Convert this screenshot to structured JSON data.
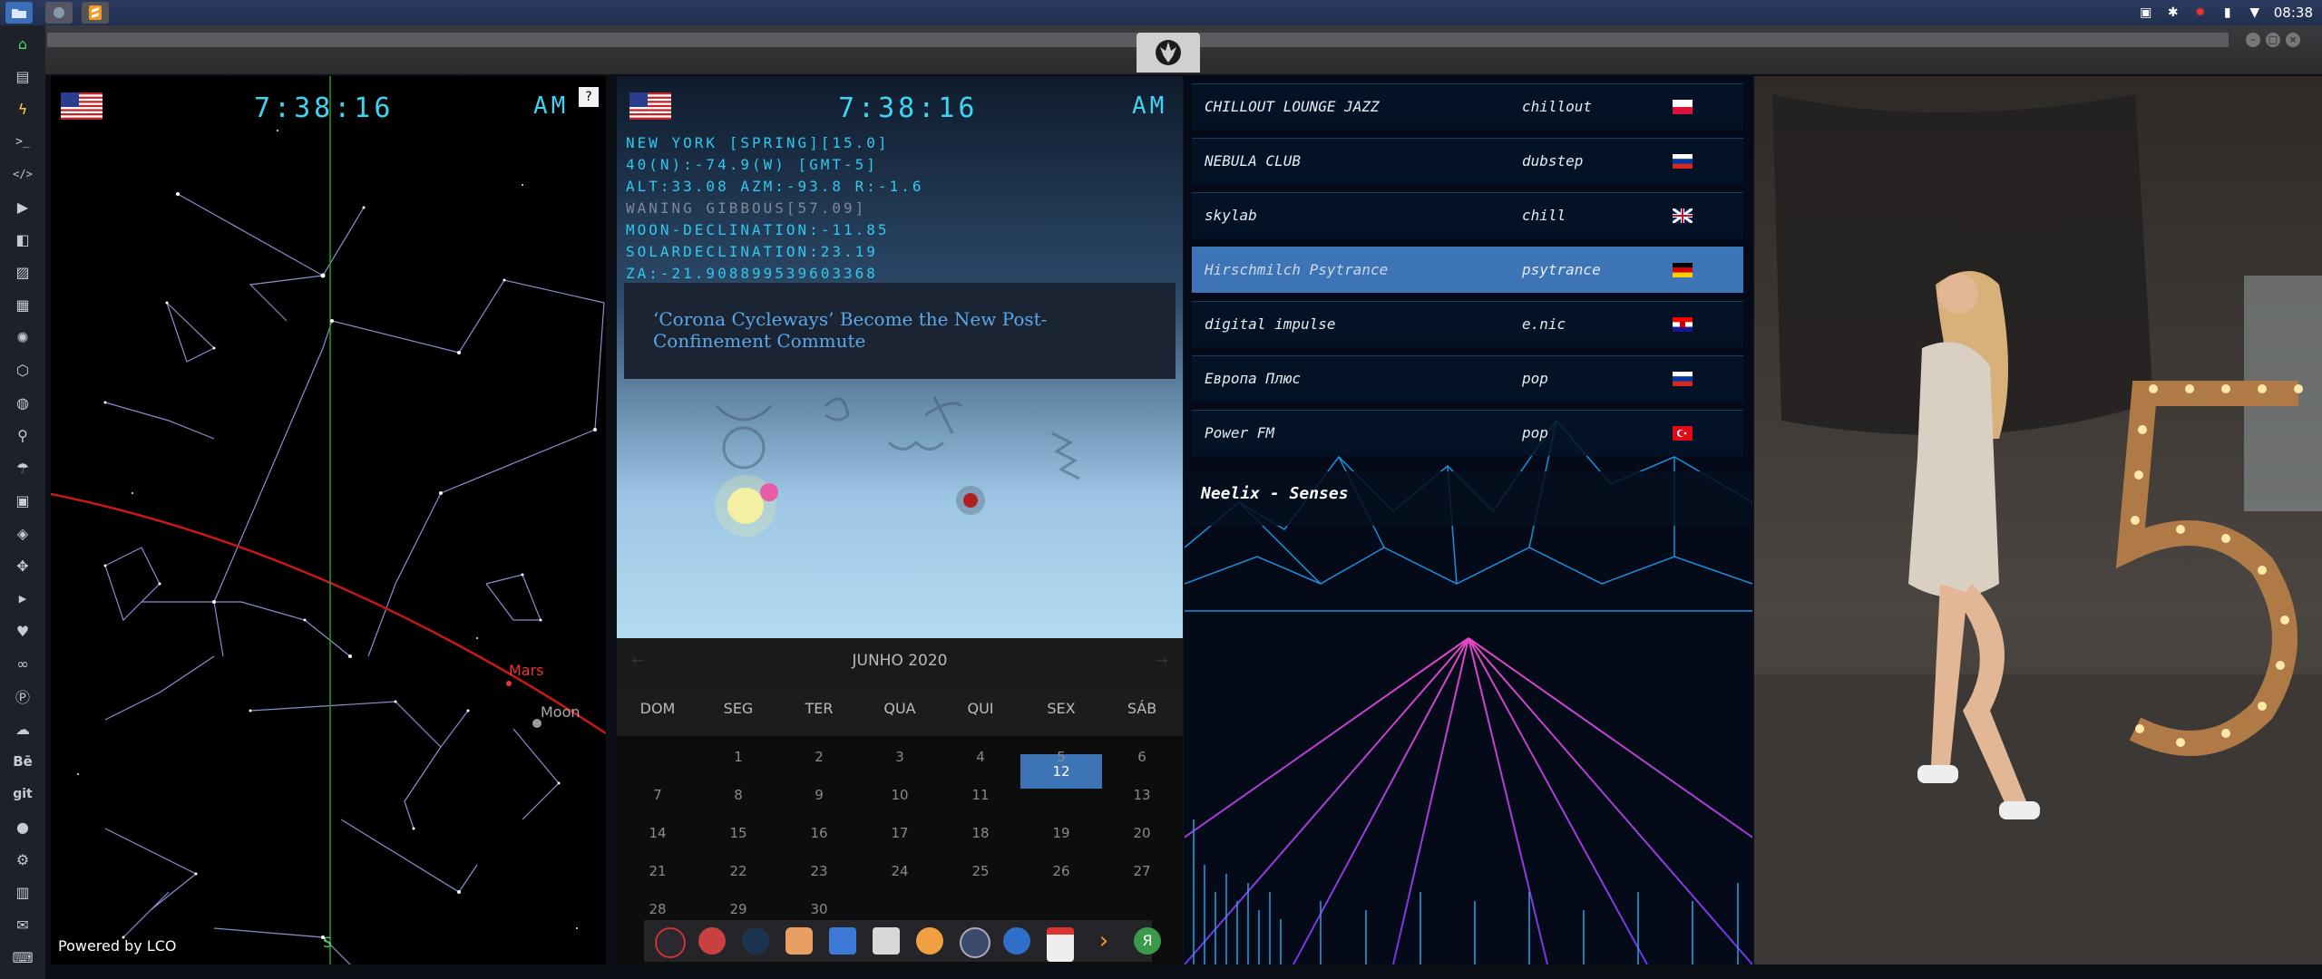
{
  "panel": {
    "time": "08:38"
  },
  "sky": {
    "clock": "7:38:16",
    "ampm": "AM",
    "help": "?",
    "mars_label": "Mars",
    "moon_label": "Moon",
    "south_label": "S",
    "powered_by": "Powered by LCO"
  },
  "astro": {
    "clock": "7:38:16",
    "ampm": "AM",
    "info": [
      "NEW YORK [SPRING][15.0]",
      "40(N):-74.9(W) [GMT-5]",
      "ALT:33.08 AZM:-93.8 R:-1.6",
      "WANING GIBBOUS[57.09]",
      "MOON-DECLINATION:-11.85",
      "SOLARDECLINATION:23.19",
      "ZA:-21.908899539603368"
    ],
    "news_headline": "‘Corona Cycleways’ Become the New Post-Confinement Commute",
    "calendar": {
      "month": "JUNHO 2020",
      "weekdays": [
        "DOM",
        "SEG",
        "TER",
        "QUA",
        "QUI",
        "SEX",
        "SÁB"
      ],
      "today": "12",
      "weeks": [
        [
          "",
          "1",
          "2",
          "3",
          "4",
          "5",
          "6"
        ],
        [
          "7",
          "8",
          "9",
          "10",
          "11",
          "12",
          "13"
        ],
        [
          "14",
          "15",
          "16",
          "17",
          "18",
          "19",
          "20"
        ],
        [
          "21",
          "22",
          "23",
          "24",
          "25",
          "26",
          "27"
        ],
        [
          "28",
          "29",
          "30",
          "",
          "",
          "",
          ""
        ]
      ]
    },
    "dock_icons": [
      "launcher-icon",
      "hourglass-icon",
      "globe-icon",
      "photos-icon",
      "translate-icon",
      "browser-icon",
      "search-icon",
      "clock-icon",
      "web-icon",
      "calendar-icon",
      "sublime-icon",
      "yandex-icon"
    ]
  },
  "radio": {
    "stations": [
      {
        "name": "CHILLOUT LOUNGE JAZZ",
        "genre": "chillout",
        "flag": "poland"
      },
      {
        "name": "NEBULA CLUB",
        "genre": "dubstep",
        "flag": "russia"
      },
      {
        "name": "skylab",
        "genre": "chill",
        "flag": "uk"
      },
      {
        "name": "Hirschmilch Psytrance",
        "genre": "psytrance",
        "flag": "germany"
      },
      {
        "name": "digital impulse",
        "genre": "e.nic",
        "flag": "croatia"
      },
      {
        "name": "Европа Плюс",
        "genre": "pop",
        "flag": "russia"
      },
      {
        "name": "Power FM",
        "genre": "pop",
        "flag": "turkey"
      }
    ],
    "selected_index": 3,
    "now_playing": "Neelix - Senses"
  },
  "colors": {
    "accent": "#3d74b6",
    "lcd": "#3fd4f2",
    "ecliptic": "#c81818",
    "meridian": "#1fa31f"
  }
}
